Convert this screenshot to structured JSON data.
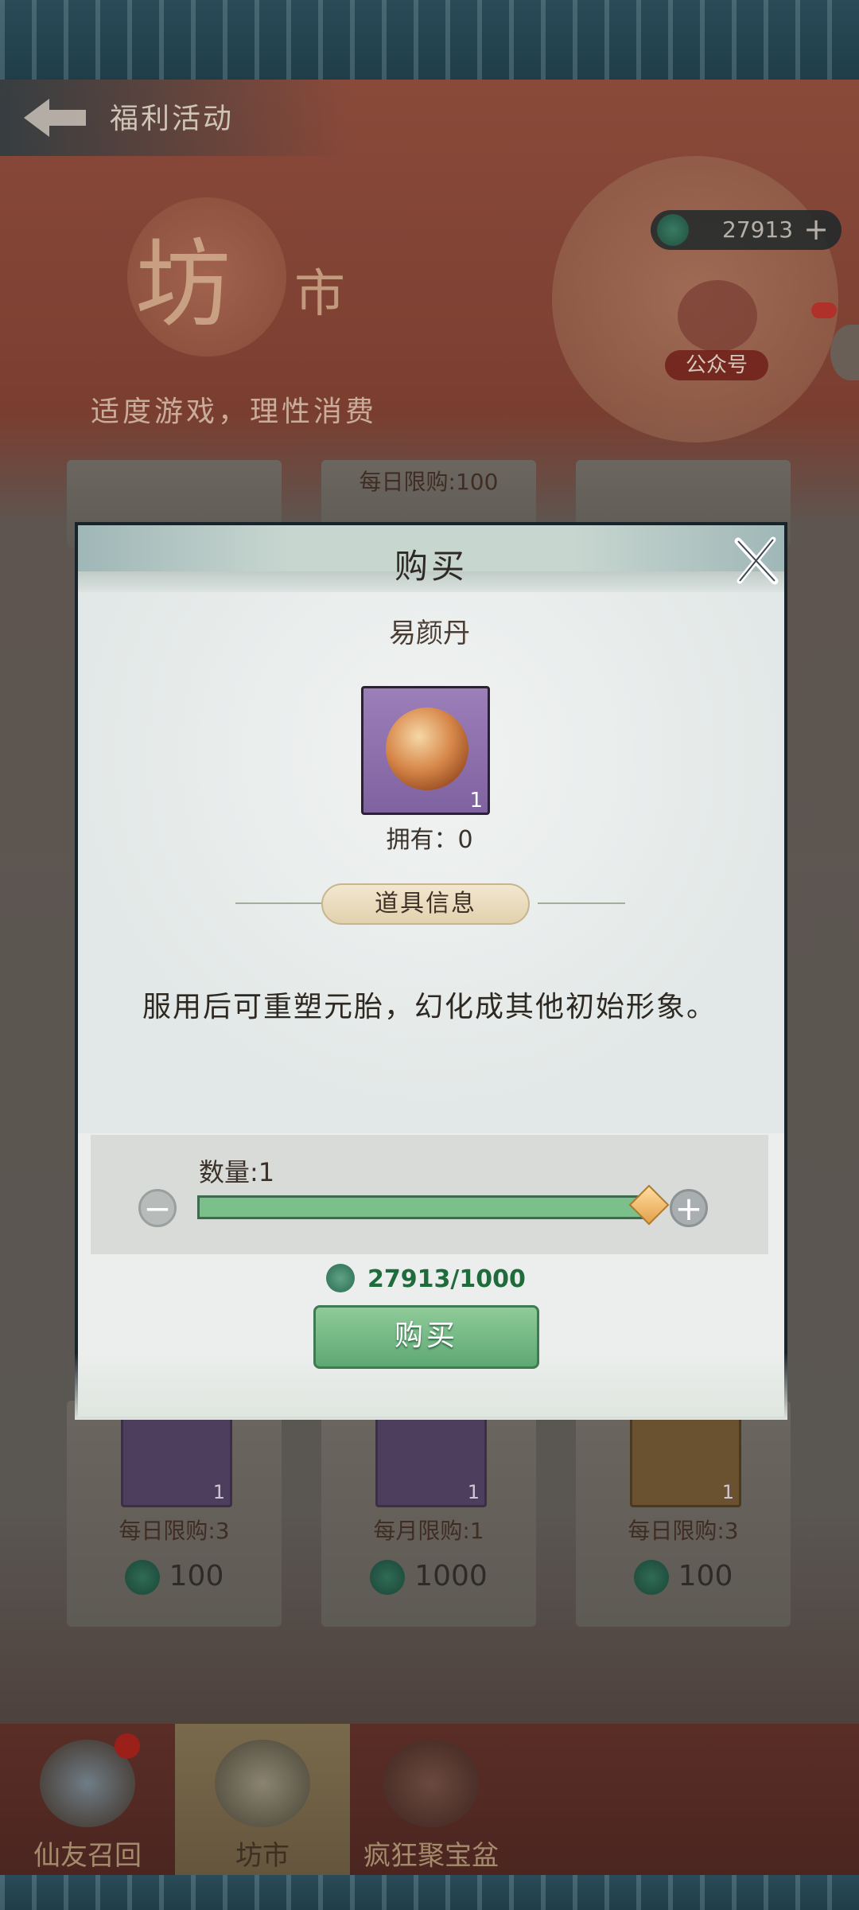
{
  "header": {
    "title": "福利活动"
  },
  "banner": {
    "shop_title_big": "坊",
    "shop_title_small": "市",
    "slogan": "适度游戏，理性消费",
    "currency_value": "27913",
    "currency_plus": "+",
    "wechat_label": "公众号"
  },
  "background_cards": {
    "top_middle_limit": "每日限购:100",
    "bottom": [
      {
        "limit": "每日限购:3",
        "price": "100",
        "qty": "1"
      },
      {
        "limit": "每月限购:1",
        "price": "1000",
        "qty": "1"
      },
      {
        "limit": "每日限购:3",
        "price": "100",
        "qty": "1"
      }
    ]
  },
  "modal": {
    "title": "购买",
    "item_name": "易颜丹",
    "item_qty_badge": "1",
    "owned": "拥有：0",
    "info_tag": "道具信息",
    "description": "服用后可重塑元胎，幻化成其他初始形象。",
    "quantity_label": "数量:1",
    "minus": "−",
    "plus": "+",
    "slider_fill_fraction": 1.0,
    "cost": "27913/1000",
    "buy_button": "购买"
  },
  "bottom_nav": {
    "tabs": [
      {
        "label": "仙友召回",
        "active": false,
        "badge": true
      },
      {
        "label": "坊市",
        "active": true,
        "badge": false
      },
      {
        "label": "疯狂聚宝盆",
        "active": false,
        "badge": false
      }
    ]
  },
  "colors": {
    "accent_green": "#5ea874",
    "cost_green": "#1f6b3c",
    "item_purple": "#9c7fb9"
  }
}
